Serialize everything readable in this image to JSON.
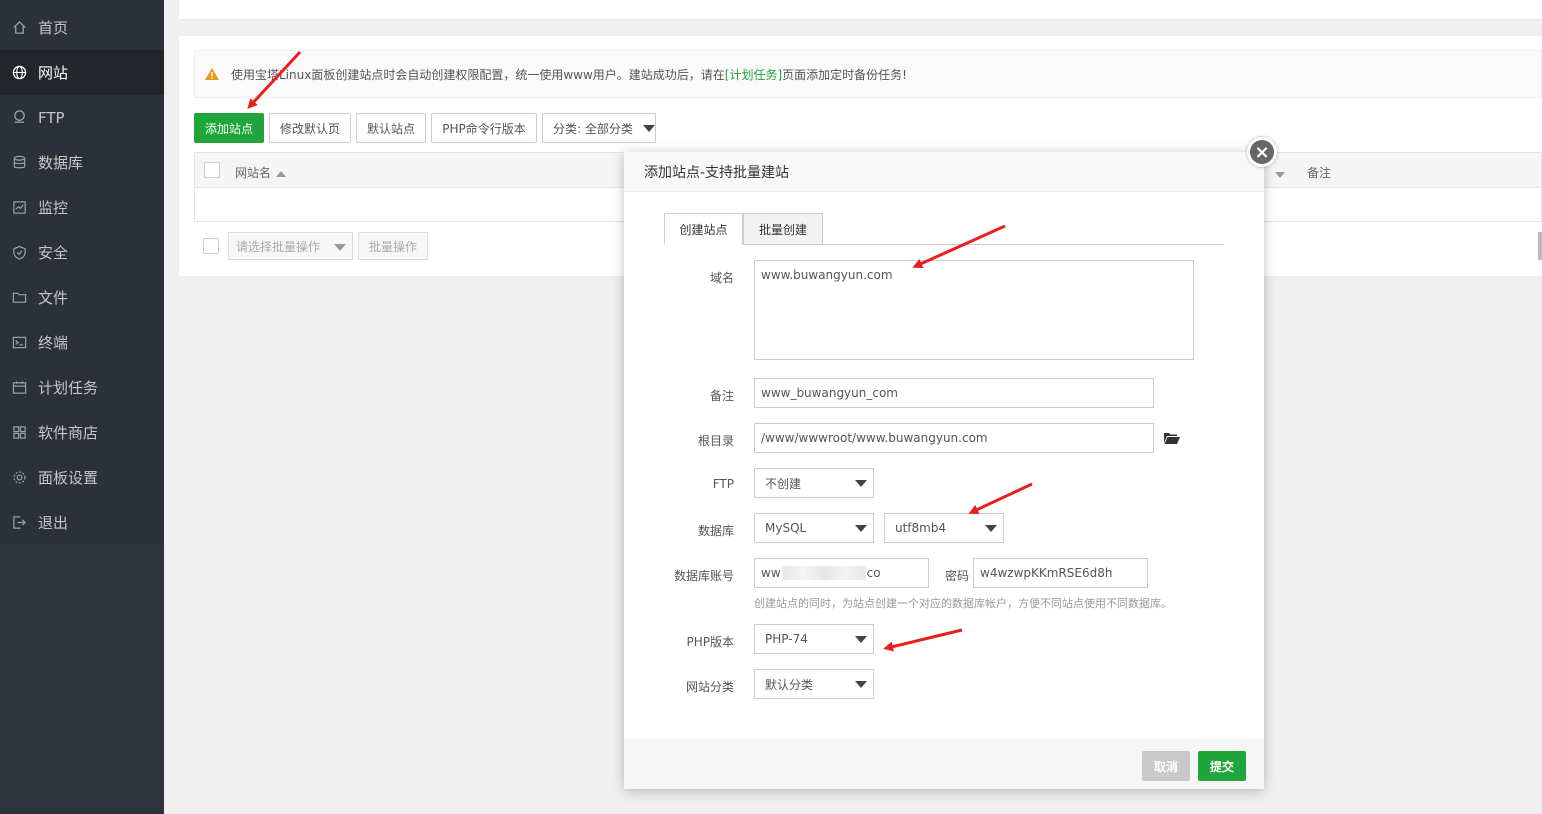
{
  "sidebar": {
    "items": [
      {
        "label": "首页",
        "icon": "home-icon"
      },
      {
        "label": "网站",
        "icon": "globe-icon"
      },
      {
        "label": "FTP",
        "icon": "ftp-icon"
      },
      {
        "label": "数据库",
        "icon": "database-icon"
      },
      {
        "label": "监控",
        "icon": "monitor-icon"
      },
      {
        "label": "安全",
        "icon": "shield-icon"
      },
      {
        "label": "文件",
        "icon": "folder-icon"
      },
      {
        "label": "终端",
        "icon": "terminal-icon"
      },
      {
        "label": "计划任务",
        "icon": "calendar-icon"
      },
      {
        "label": "软件商店",
        "icon": "grid-icon"
      },
      {
        "label": "面板设置",
        "icon": "gear-icon"
      },
      {
        "label": "退出",
        "icon": "logout-icon"
      }
    ],
    "active_index": 1
  },
  "notice": {
    "prefix": "使用宝塔Linux面板创建站点时会自动创建权限配置，统一使用www用户。建站成功后，请在",
    "link": "[计划任务]",
    "suffix": "页面添加定时备份任务!"
  },
  "toolbar": {
    "add_site": "添加站点",
    "edit_default_page": "修改默认页",
    "default_site": "默认站点",
    "php_cli_version": "PHP命令行版本",
    "category_select": "分类: 全部分类"
  },
  "table": {
    "col_site_name": "网站名",
    "col_note": "备注"
  },
  "batch": {
    "select_placeholder": "请选择批量操作",
    "button": "批量操作"
  },
  "modal": {
    "title": "添加站点-支持批量建站",
    "close": "×",
    "tabs": [
      "创建站点",
      "批量创建"
    ],
    "fields": {
      "domain_label": "域名",
      "domain_value": "www.buwangyun.com",
      "note_label": "备注",
      "note_value": "www_buwangyun_com",
      "root_label": "根目录",
      "root_value": "/www/wwwroot/www.buwangyun.com",
      "ftp_label": "FTP",
      "ftp_value": "不创建",
      "db_label": "数据库",
      "db_type": "MySQL",
      "db_charset": "utf8mb4",
      "db_account_label": "数据库账号",
      "db_account_prefix": "ww",
      "db_account_suffix": "co",
      "password_label": "密码",
      "password_value": "w4wzwpKKmRSE6d8h",
      "db_hint": "创建站点的同时，为站点创建一个对应的数据库帐户，方便不同站点使用不同数据库。",
      "php_label": "PHP版本",
      "php_value": "PHP-74",
      "category_label": "网站分类",
      "category_value": "默认分类"
    },
    "footer": {
      "cancel": "取消",
      "submit": "提交"
    }
  },
  "colors": {
    "sidebar_bg": "#2c3038",
    "sidebar_active": "#222529",
    "accent_green": "#20a53a",
    "annotation_red": "#e8201c"
  }
}
